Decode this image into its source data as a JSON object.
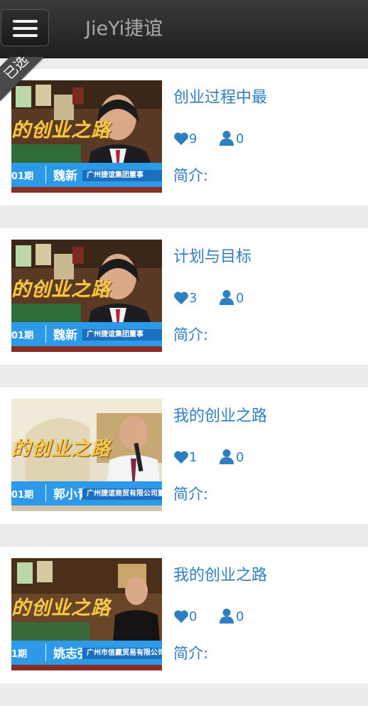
{
  "header": {
    "title": "JieYi捷谊",
    "menu_icon": "hamburger-menu-icon"
  },
  "selected_badge": "已选",
  "intro_label": "简介:",
  "cards": [
    {
      "title": "创业过程中最",
      "likes": "9",
      "views": "0",
      "thumbnail": {
        "banner": "的创业之路",
        "episode": "01期",
        "name": "魏新",
        "company": "广州捷谊集团董事"
      }
    },
    {
      "title": "计划与目标",
      "likes": "3",
      "views": "0",
      "thumbnail": {
        "banner": "的创业之路",
        "episode": "01期",
        "name": "魏新",
        "company": "广州捷谊集团董事"
      }
    },
    {
      "title": "我的创业之路",
      "likes": "1",
      "views": "0",
      "thumbnail": {
        "banner": "的创业之路",
        "episode": "01期",
        "name": "郭小青",
        "company": "广州捷谊商贸有限公司董事"
      }
    },
    {
      "title": "我的创业之路",
      "likes": "0",
      "views": "0",
      "thumbnail": {
        "banner": "的创业之路",
        "episode": "1期",
        "name": "姚志强",
        "company": "广州市信嬴贸易有限公司"
      }
    }
  ],
  "colors": {
    "accent": "#2f7fc0",
    "header_bg": "#2a2a2a",
    "banner_blue": "#2c9ae8"
  }
}
